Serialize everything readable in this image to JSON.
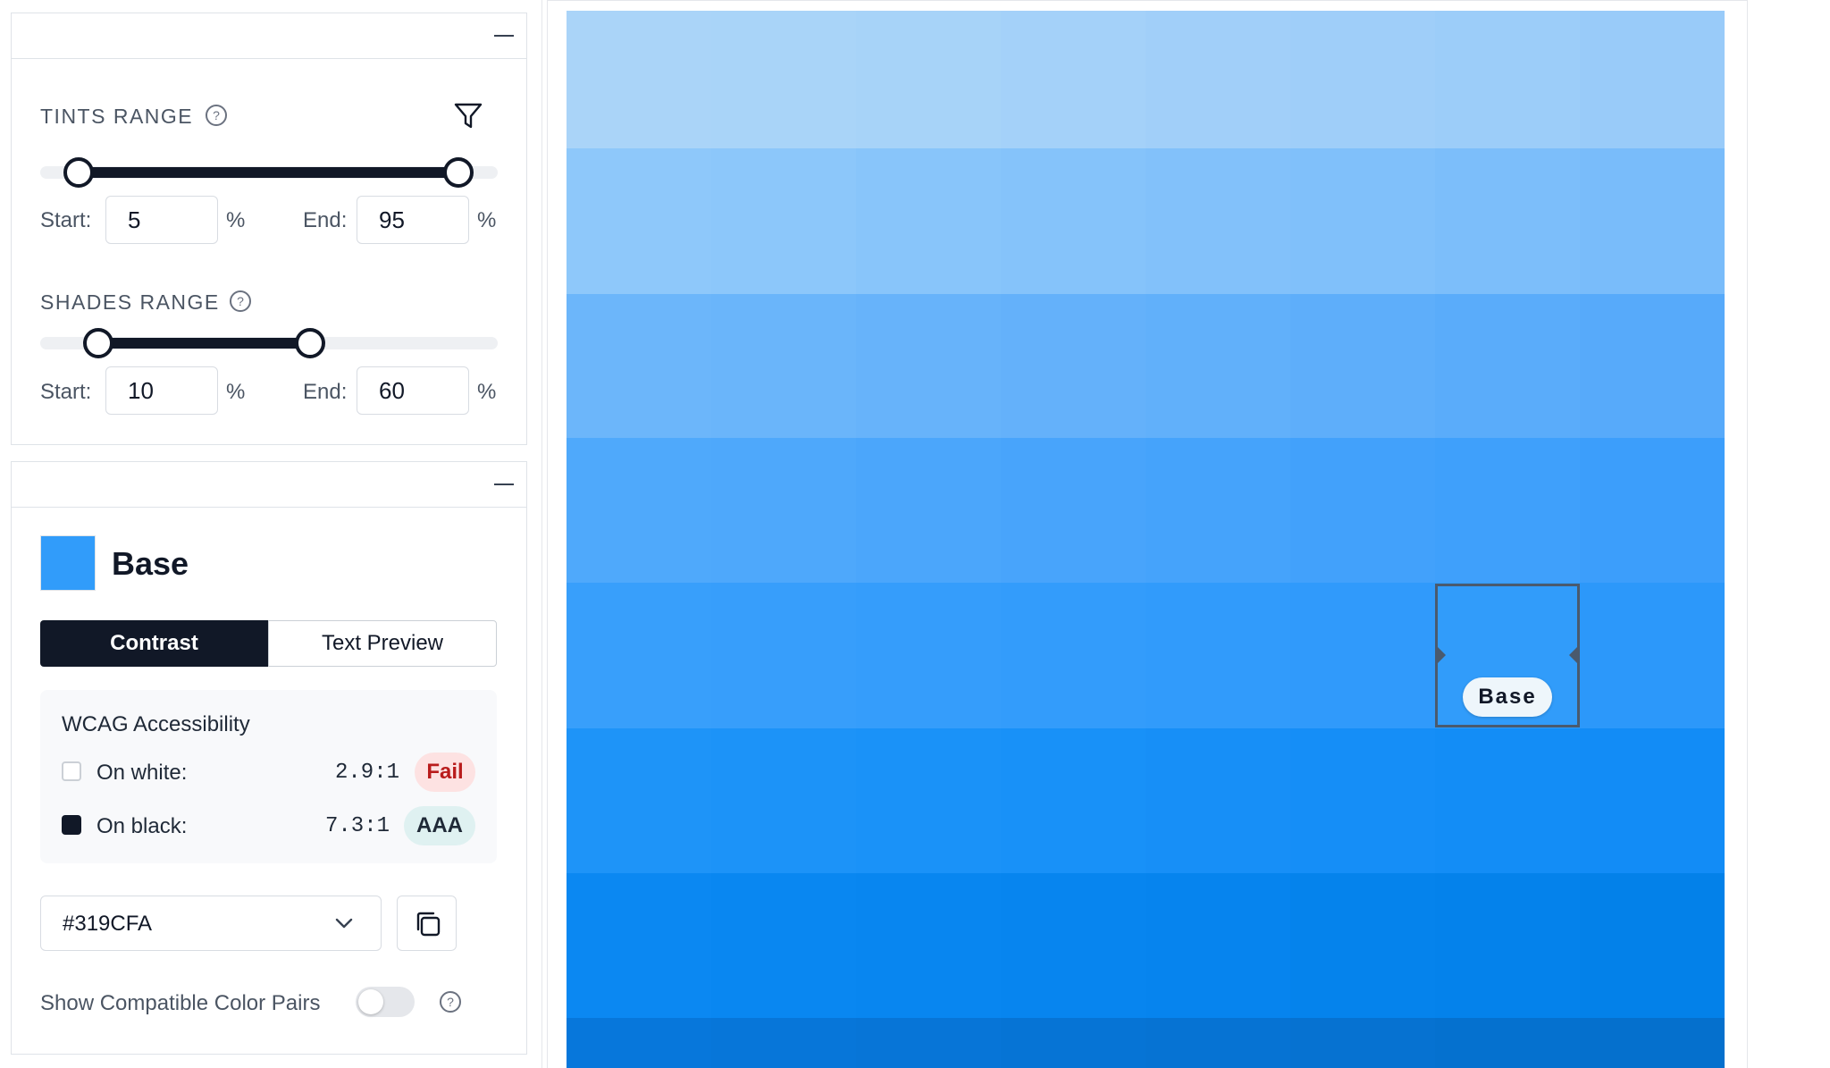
{
  "tints_panel": {
    "label": "TINTS RANGE",
    "start_label": "Start:",
    "start_value": "5",
    "end_label": "End:",
    "end_value": "95",
    "unit": "%"
  },
  "shades_panel": {
    "label": "SHADES RANGE",
    "start_label": "Start:",
    "start_value": "10",
    "end_label": "End:",
    "end_value": "60",
    "unit": "%"
  },
  "base_panel": {
    "title": "Base",
    "swatch_color": "#319CFA",
    "tabs": [
      {
        "label": "Contrast",
        "active": true
      },
      {
        "label": "Text Preview",
        "active": false
      }
    ],
    "wcag": {
      "heading": "WCAG Accessibility",
      "rows": [
        {
          "label": "On white:",
          "ratio": "2.9:1",
          "badge": "Fail"
        },
        {
          "label": "On black:",
          "ratio": "7.3:1",
          "badge": "AAA"
        }
      ]
    },
    "hex_value": "#319CFA",
    "compatible_label": "Show Compatible Color Pairs",
    "compatible_enabled": false
  },
  "palette": {
    "base_badge": "Base",
    "rows": [
      [
        "#aad4f8",
        "#a9d4f8",
        "#a7d3f8",
        "#a4d1f9",
        "#a1cff9",
        "#9fcef9",
        "#9ccdf9",
        "#99cbf9"
      ],
      [
        "#8ec8fa",
        "#8cc7fa",
        "#88c5fa",
        "#85c3fa",
        "#82c1fa",
        "#80c0fa",
        "#7cbefa",
        "#79bcfa"
      ],
      [
        "#6cb6fa",
        "#6ab5fa",
        "#67b3fa",
        "#64b1fa",
        "#61b0fa",
        "#5eaefa",
        "#5aacfa",
        "#57aafa"
      ],
      [
        "#4fa9fb",
        "#4ea8fb",
        "#4ba6fb",
        "#48a4fb",
        "#45a3fb",
        "#42a1fb",
        "#3fa0fb",
        "#3c9efb"
      ],
      [
        "#389ffb",
        "#379efb",
        "#359dfb",
        "#339cfb",
        "#319bfb",
        "#309afb",
        "#319cfa",
        "#2c98fa"
      ],
      [
        "#1e94f8",
        "#1c93f8",
        "#1a92f8",
        "#1891f8",
        "#178ff7",
        "#158ef7",
        "#138df6",
        "#128cf6"
      ],
      [
        "#0b88f2",
        "#0987f1",
        "#0886f0",
        "#0785ef",
        "#0684ee",
        "#0583ec",
        "#0482eb",
        "#0381e9"
      ],
      [
        "#0777db",
        "#0776d9",
        "#0775d7",
        "#0674d5",
        "#0673d3",
        "#0672d1",
        "#0571cf",
        "#0570cd"
      ]
    ]
  }
}
